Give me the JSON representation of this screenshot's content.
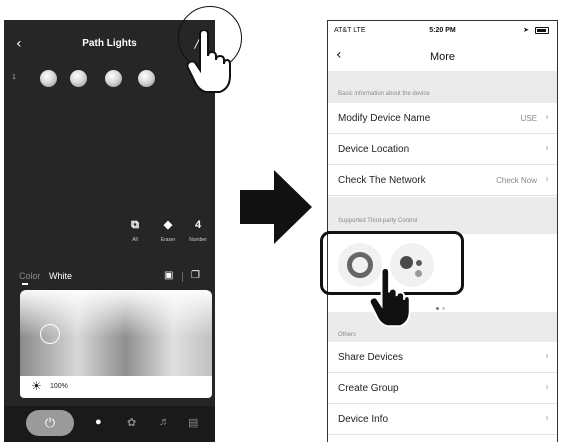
{
  "left_screen": {
    "title": "Path Lights",
    "light_index": "1",
    "light_count": 4,
    "tools": [
      {
        "label": "All",
        "icon": "select-all-icon",
        "glyph": "⧉"
      },
      {
        "label": "Eraser",
        "icon": "eraser-icon",
        "glyph": "◆"
      },
      {
        "label": "Number",
        "icon": "number-icon",
        "glyph": "4"
      }
    ],
    "tabs": {
      "color": "Color",
      "white": "White"
    },
    "brightness": "100%",
    "bottom_nav": [
      "power-icon",
      "bulb-icon",
      "palette-icon",
      "music-icon",
      "timer-icon"
    ]
  },
  "right_screen": {
    "status": {
      "carrier": "AT&T  LTE",
      "time": "5:20 PM"
    },
    "title": "More",
    "sections": {
      "basic": "Basic information about the device",
      "third_party": "Supported Third-party Control",
      "others": "Others"
    },
    "basic_rows": [
      {
        "label": "Modify Device Name",
        "value": "USE"
      },
      {
        "label": "Device Location",
        "value": ""
      },
      {
        "label": "Check The Network",
        "value": "Check Now"
      }
    ],
    "other_rows": [
      {
        "label": "Share Devices"
      },
      {
        "label": "Create Group"
      },
      {
        "label": "Device Info"
      }
    ],
    "third_party_icons": [
      "alexa-icon",
      "google-assistant-icon"
    ]
  },
  "colors": {
    "dark_bg": "#262626",
    "section_bg": "#ebebeb",
    "google_blue": "#4a4a4a"
  }
}
